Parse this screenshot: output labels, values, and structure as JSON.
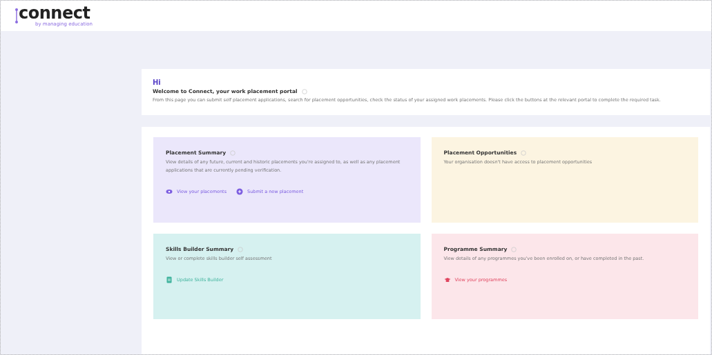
{
  "header": {
    "logo": "connect",
    "tagline": "by managing education"
  },
  "welcome": {
    "greeting": "Hi",
    "title": "Welcome to Connect, your work placement portal",
    "text": "From this page you can submit self placement applications, search for placement opportunities, check the status of your assigned work placements. Please click the buttons at the relevant portal to complete the required task."
  },
  "cards": [
    {
      "title": "Placement Summary",
      "text": "View details of any future, current and historic placements you're assigned to, as well as any placement applications that are currently pending verification.",
      "color": "#ebe7fb",
      "links": [
        {
          "label": "View your placements",
          "kind": "eye",
          "color": "#7b5ce0"
        },
        {
          "label": "Submit a new placement",
          "kind": "plus",
          "color": "#7b5ce0"
        }
      ]
    },
    {
      "title": "Placement Opportunities",
      "text": "Your organisation doesn't have access to placement opportunities",
      "color": "#fcf4e1"
    },
    {
      "title": "Skills Builder Summary",
      "text": "View or complete skills builder self assessment",
      "color": "#d6f1f0",
      "links": [
        {
          "label": "Update Skills Builder",
          "kind": "doc",
          "color": "#3fb39d"
        }
      ]
    },
    {
      "title": "Programme Summary",
      "text": "View details of any programmes you've been enrolled on, or have completed in the past.",
      "color": "#fce6ea",
      "links": [
        {
          "label": "View your programmes",
          "kind": "hat",
          "color": "#e0455f"
        }
      ]
    }
  ]
}
